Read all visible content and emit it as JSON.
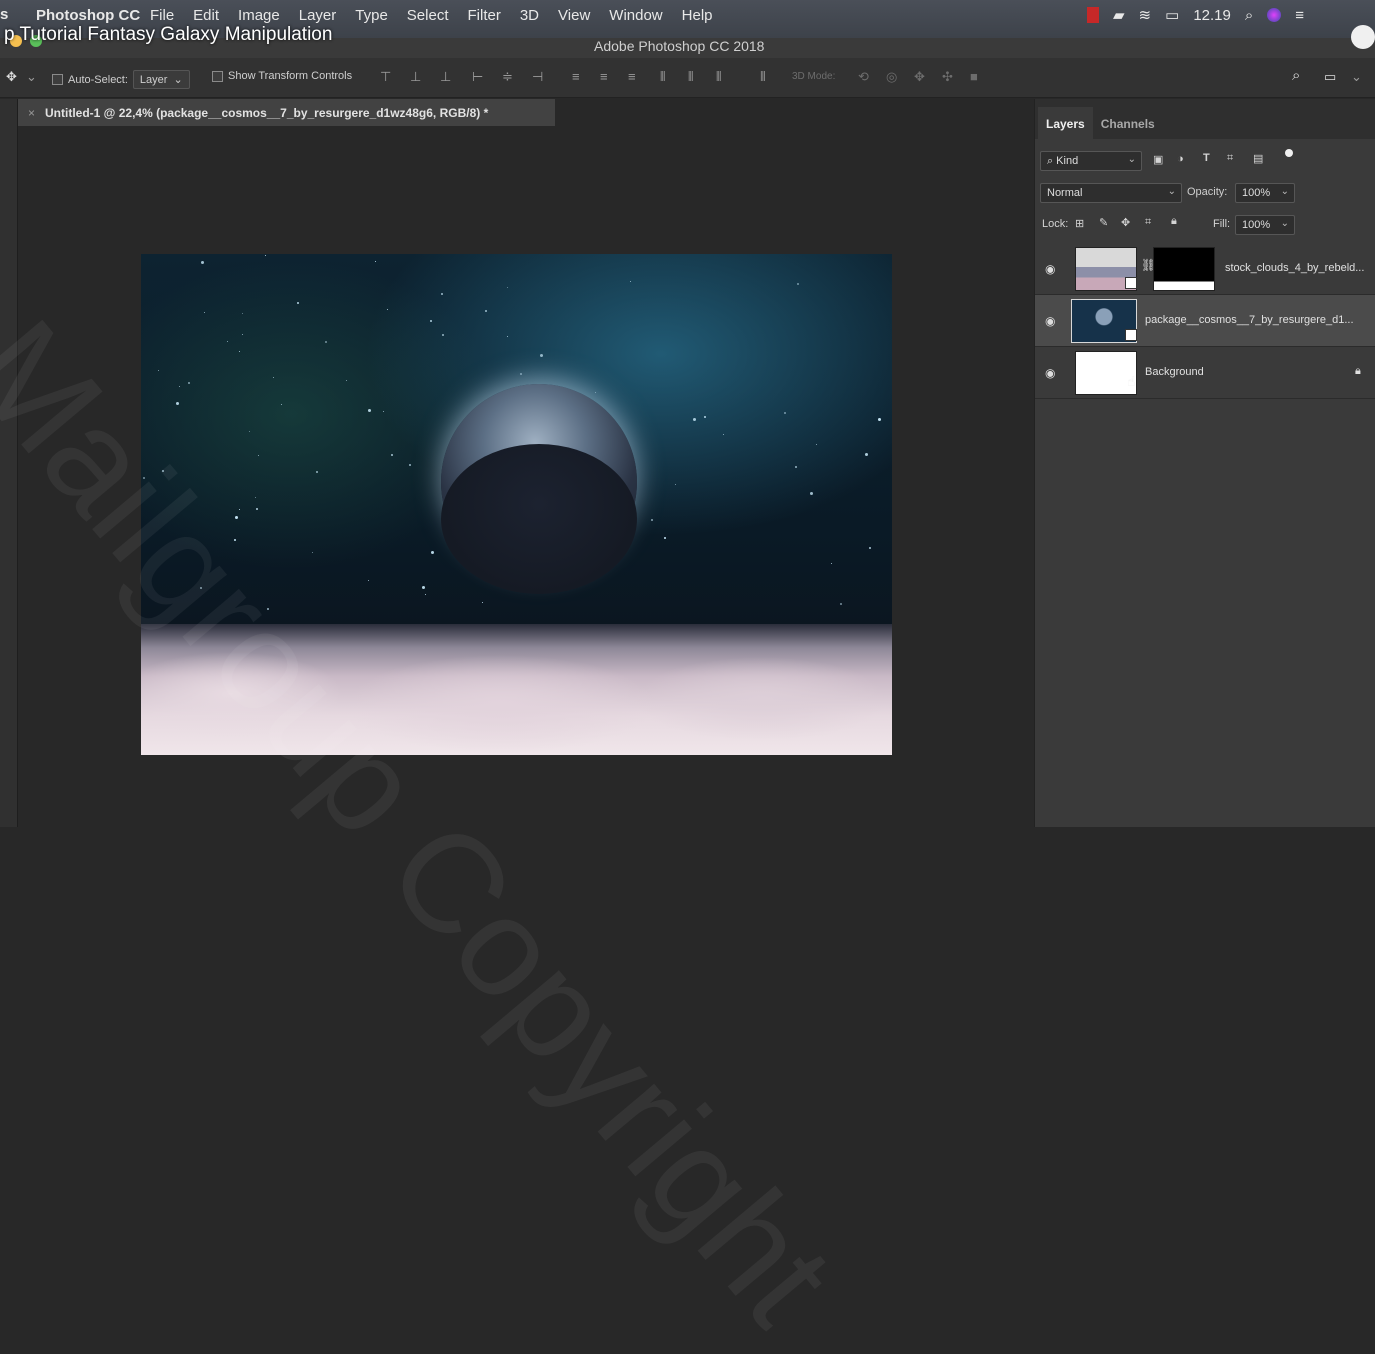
{
  "menubar": {
    "app_logo": "s",
    "app_name": "Photoshop CC",
    "menus": [
      "File",
      "Edit",
      "Image",
      "Layer",
      "Type",
      "Select",
      "Filter",
      "3D",
      "View",
      "Window",
      "Help"
    ],
    "video_title": "p Tutorial Fantasy Galaxy Manipulation",
    "time": "12.19"
  },
  "window": {
    "title": "Adobe Photoshop CC 2018"
  },
  "options": {
    "auto_select_label": "Auto-Select:",
    "auto_select_value": "Layer",
    "show_transform_label": "Show Transform Controls",
    "mode_3d_label": "3D Mode:"
  },
  "document": {
    "tab_title": "Untitled-1 @ 22,4% (package__cosmos__7_by_resurgere_d1wz48g6, RGB/8) *",
    "close_glyph": "×"
  },
  "watermark": {
    "text": "Mailgroup Copyright"
  },
  "panel": {
    "tabs": [
      "Layers",
      "Channels"
    ],
    "filter_label": "Kind",
    "blend_mode": "Normal",
    "opacity_label": "Opacity:",
    "opacity_value": "100%",
    "lock_label": "Lock:",
    "fill_label": "Fill:",
    "fill_value": "100%",
    "layers": [
      {
        "name": "stock_clouds_4_by_rebeld..."
      },
      {
        "name": "package__cosmos__7_by_resurgere_d1..."
      },
      {
        "name": "Background"
      }
    ]
  },
  "colors": {
    "accent_selection": "#4b4b4b",
    "panel_bg": "#3a3a3a",
    "canvas_bg": "#282828"
  }
}
